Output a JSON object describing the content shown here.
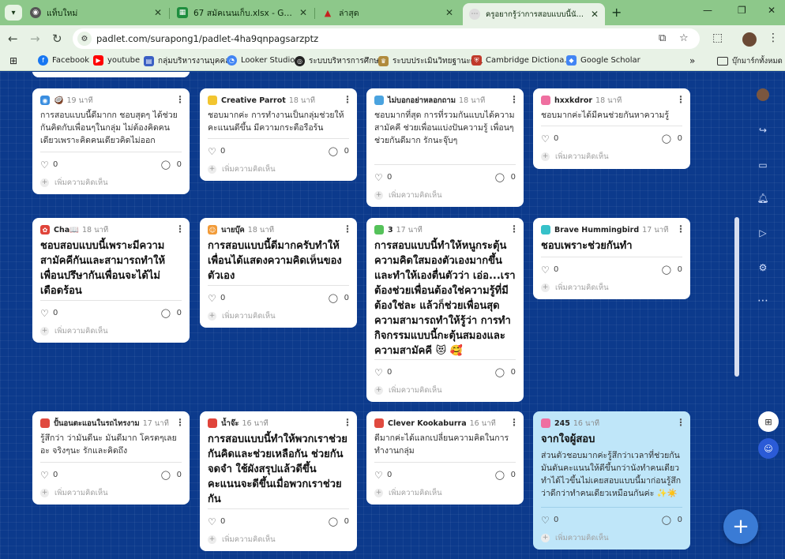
{
  "browser": {
    "tabs": [
      {
        "label": "แท็บใหม่",
        "icon": "chrome-icon",
        "color": "#555555"
      },
      {
        "label": "67 สมัคเนนเก็บ.xlsx - Google ชีต",
        "icon": "sheets-icon",
        "color": "#1e8e3e"
      },
      {
        "label": "ล่าสุด",
        "icon": "drive-icon",
        "color": "#c5221f"
      },
      {
        "label": "ครูอยากรู้ว่าการสอบแบบนี้นักเรียนรู้สึ",
        "icon": "padlet-icon",
        "color": "#888888"
      }
    ],
    "url": "padlet.com/surapong1/padlet-4ha9qnpagsarzptz",
    "bookmarks": [
      {
        "label": "Facebook",
        "color": "#1877f2"
      },
      {
        "label": "youtube",
        "color": "#ff0000"
      },
      {
        "label": "กลุ่มบริหารงานบุคคล",
        "color": "#3b5fc4"
      },
      {
        "label": "Looker Studio",
        "color": "#4285f4"
      },
      {
        "label": "ระบบบริหารการศึกษา",
        "color": "#222222"
      },
      {
        "label": "ระบบประเมินวิทยฐานะดิ...",
        "color": "#b08a3c"
      },
      {
        "label": "Cambridge Dictiona...",
        "color": "#c0392b"
      },
      {
        "label": "Google Scholar",
        "color": "#4285f4"
      }
    ],
    "bookmarks_more": "»",
    "all_bookmarks": "บุ๊กมาร์กทั้งหมด"
  },
  "cards": [
    {
      "author": "",
      "time": "19 นาที",
      "avatar_color": "#3a8ee0",
      "body": "การสอบแบบนี้ดีมากก ชอบสุดๆ ได้ช่วยกันคิดกับเพื่อนๆในกลุ่ม ไม่ต้องคิดคนเดียวเพราะคิดคนเดียวคิดไม่ออก",
      "likes": "0",
      "comments": "0",
      "add_comment": "เพิ่มความคิดเห็น"
    },
    {
      "author": "Creative Parrot",
      "time": "18 นาที",
      "avatar_color": "#f2c530",
      "body": "ชอบมากค่ะ การทำงานเป็นกลุ่มช่วยให้คะแนนดีขึ้น มีความกระตือรือร้น",
      "likes": "0",
      "comments": "0",
      "add_comment": "เพิ่มความคิดเห็น"
    },
    {
      "author": "ไม่บอกอย่าหลอกถาม",
      "time": "18 นาที",
      "avatar_color": "#4aa3df",
      "body": "ชอบมากที่สุด การที่รวมกันแบบได้ความสามัคคี ช่วยเพื่อนแบ่งปันความรู้ เพื่อนๆช่วยกันดีมาก รักนะจุ๊บๆ",
      "likes": "0",
      "comments": "0",
      "add_comment": "เพิ่มความคิดเห็น"
    },
    {
      "author": "hxxkdror",
      "time": "18 นาที",
      "avatar_color": "#ef6fa0",
      "body": "ชอบมากค่ะได้มีคนช่วยกันหาความรู้",
      "likes": "0",
      "comments": "0",
      "add_comment": "เพิ่มความคิดเห็น"
    },
    {
      "author": "Cha📖",
      "time": "18 นาที",
      "avatar_color": "#e0443a",
      "title": "ชอบสอบแบบนี้เพราะมีความสามัคคีกันและสามารถทำให้เพื่อนปรึษากันเพื่อนจะได้ไม่เดือดร้อน",
      "likes": "0",
      "comments": "0",
      "add_comment": "เพิ่มความคิดเห็น"
    },
    {
      "author": "นายบุ๊ค",
      "time": "18 นาที",
      "avatar_color": "#f29b38",
      "title": "การสอบแบบนี้ดีมากครับทำให้เพื่อนได้แสดงความคิดเห็นของตัวเอง",
      "likes": "0",
      "comments": "0",
      "add_comment": "เพิ่มความคิดเห็น"
    },
    {
      "author": "3",
      "time": "17 นาที",
      "avatar_color": "#55c25a",
      "title": "การสอบแบบนี้ทำให้หนูกระตุ้นความคิดใสมองตัวเองมากขึ้นและทำให้เองตื่นตัวว่า เอ่อ...เราต้องช่วยเพื่อนต้องใช่ความรู้ที่มีต้องใช่ละ แล้วก็ช่วยเพื่อนสุดความสามารถทำให้รู้ว่า การทำกิจกรรมแบบนี้กะตุ้นสมองและความสามัคคี 😻 🥰",
      "likes": "0",
      "comments": "0",
      "add_comment": "เพิ่มความคิดเห็น"
    },
    {
      "author": "Brave Hummingbird",
      "time": "17 นาที",
      "avatar_color": "#36c1c9",
      "title": "ชอบเพราะช่วยกันทำ",
      "likes": "0",
      "comments": "0",
      "add_comment": "เพิ่มความคิดเห็น"
    },
    {
      "author": "ปั้นอนตะแอนในรถไทรงาม",
      "time": "17 นาที",
      "avatar_color": "#e04a3f",
      "body": "รู้สึกว่า ว่ามันดีนะ มันดีมาก โครตๆเลยอะ จริงๆนะ รักและคิดถึง",
      "likes": "0",
      "comments": "0",
      "add_comment": "เพิ่มความคิดเห็น"
    },
    {
      "author": "น้ำจ๊ะ",
      "time": "16 นาที",
      "avatar_color": "#e0443a",
      "title": "การสอบแบบนี้ทำให้พวกเราช่วยกันคิดและช่วยเหลือกัน ช่วยกันจดจำ ใช้ผังสรุปแล้วดีขึ้นคะแนนจะดีขึ้นเมื่อพวกเราช่วยกัน",
      "likes": "0",
      "comments": "0",
      "add_comment": "เพิ่มความคิดเห็น"
    },
    {
      "author": "Clever Kookaburra",
      "time": "16 นาที",
      "avatar_color": "#e04a3f",
      "body": "ดีมากค่ะได้แลกเปลี่ยนความคิดในการทำงานกลุ่ม",
      "likes": "0",
      "comments": "0",
      "add_comment": "เพิ่มความคิดเห็น"
    },
    {
      "author": "245",
      "time": "16 นาที",
      "avatar_color": "#ef6fa0",
      "title": "จากใจผู้สอบ",
      "body": "ส่วนตัวชอบมากค่ะรู้สึกว่าเวลาที่ช่วยกันมันดันคะแนนให้ดีขึ้นกว่านังทำคนเดียวทำได้ไวขึ้นไม่เคยสอบแบบนี้มาก่อนรู้สึกว่าดีกว่าทำคนเดียวเหมือนกันค่ะ ✨☀️",
      "likes": "0",
      "comments": "0",
      "add_comment": "เพิ่มความคิดเห็น"
    }
  ]
}
